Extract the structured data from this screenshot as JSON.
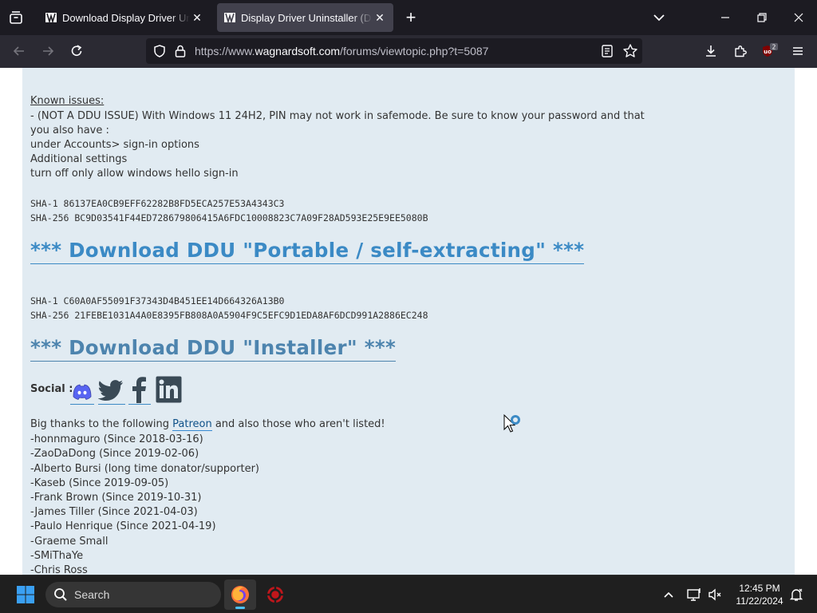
{
  "browser": {
    "tabs": [
      {
        "title": "Download Display Driver Uninst",
        "active": false
      },
      {
        "title": "Display Driver Uninstaller (DDU)",
        "active": true
      }
    ],
    "url": {
      "scheme": "https://www.",
      "host": "wagnardsoft.com",
      "path": "/forums/viewtopic.php?t=5087"
    },
    "extensions_badge": "2",
    "accent_color": "#3b8ac5"
  },
  "page": {
    "known_issues_heading": "Known issues:",
    "known_issues_lines": [
      "- (NOT A DDU ISSUE) With Windows 11 24H2, PIN may not work in safemode. Be sure to know your password and that",
      "you also have :",
      "under Accounts> sign-in options",
      "Additional settings",
      "turn off only allow windows hello sign-in"
    ],
    "hash1_sha1": "SHA-1 86137EA0CB9EFF62282B8FD5ECA257E53A4343C3",
    "hash1_sha256": "SHA-256 BC9D03541F44ED728679806415A6FDC10008823C7A09F28AD593E25E9EE5080B",
    "download_portable": "*** Download DDU \"Portable / self-extracting\" ***",
    "hash2_sha1": "SHA-1 C60A0AF55091F37343D4B451EE14D664326A13B0",
    "hash2_sha256": "SHA-256 21FEBE1031A4A0E8395FB808A0A5904F9C5EFC9D1EDA8AF6DCD991A2886EC248",
    "download_installer": "*** Download DDU \"Installer\" ***",
    "social_label": "Social :",
    "social_icons": [
      "discord-icon",
      "twitter-icon",
      "facebook-icon",
      "linkedin-icon"
    ],
    "thanks_prefix": "Big thanks to the following ",
    "thanks_link": "Patreon",
    "thanks_suffix": " and also those who aren't listed!",
    "supporters": [
      "-honnmaguro (Since 2018-03-16)",
      "-ZaoDaDong (Since 2019-02-06)",
      "-Alberto Bursi (long time donator/supporter)",
      "-Kaseb (Since 2019-09-05)",
      "-Frank Brown (Since 2019-10-31)",
      "-James Tiller (Since 2021-04-03)",
      "-Paulo Henrique (Since 2021-04-19)",
      "-Graeme Small",
      "-SMiThaYe",
      "-Chris Ross"
    ]
  },
  "taskbar": {
    "search_placeholder": "Search",
    "time": "12:45 PM",
    "date": "11/22/2024"
  }
}
